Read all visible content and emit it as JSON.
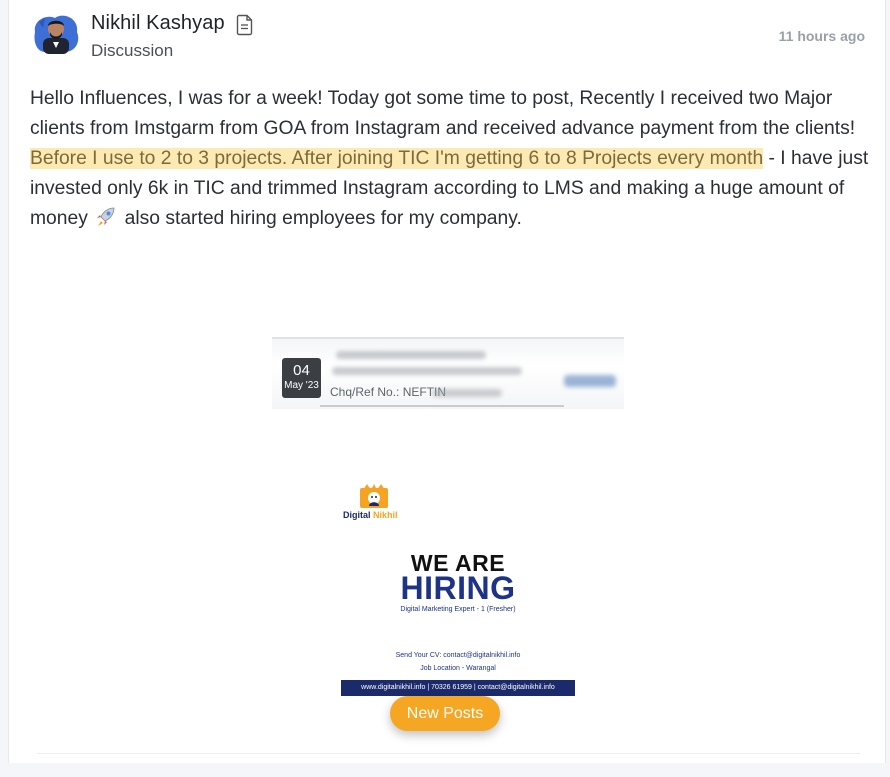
{
  "post": {
    "author": "Nikhil Kashyap",
    "type": "Discussion",
    "time_ago": "11 hours ago",
    "body_part1": "Hello Influences, I was for a week! Today got some time to post, Recently I received two Major clients from Imstgarm from GOA from Instagram and received advance payment from the clients! ",
    "body_highlight": "Before I use to 2 to 3 projects. After joining TIC I'm getting 6 to 8 Projects every month",
    "body_part2": " - I have just invested only 6k in TIC and trimmed Instagram according to LMS and making a huge amount of money ",
    "body_part3": " also started hiring employees for my company."
  },
  "bank_image": {
    "day": "04",
    "month": "May '23",
    "ref_label": "Chq/Ref No.: NEFTIN"
  },
  "poster": {
    "brand_1": "Digital ",
    "brand_2": "Nikhil",
    "headline_1": "WE ARE",
    "headline_2": "HIRING",
    "position": "Digital Marketing Expert - 1 (Fresher)",
    "cv": "Send Your CV: contact@digitalnikhil.info",
    "location": "Job Location - Warangal",
    "contact": "www.digitalnikhil.info | 70326 61959 | contact@digitalnikhil.info"
  },
  "new_posts_label": "New Posts",
  "icons": [
    "avatar",
    "document-icon",
    "rocket-emoji-icon"
  ],
  "colors": {
    "highlight_bg": "#fdeab2",
    "button": "#f5a623",
    "brand_blue": "#1d3386"
  }
}
